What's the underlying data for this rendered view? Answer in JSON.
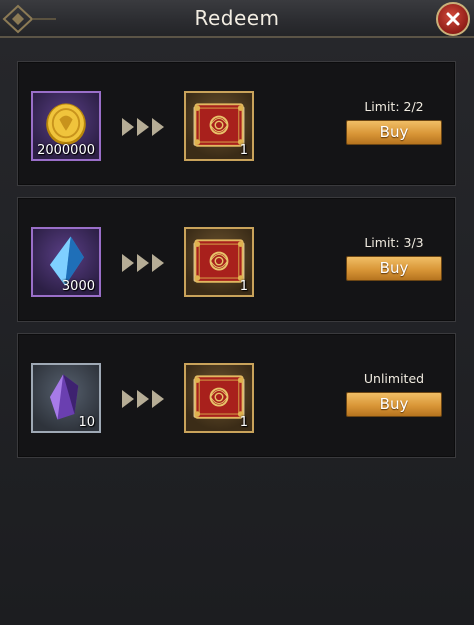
{
  "window": {
    "title": "Redeem"
  },
  "colors": {
    "buy_button": "#d99637",
    "reward_frame": "#c9a35b",
    "close_button": "#b5281f"
  },
  "offers": [
    {
      "cost_icon": "gold-coin-icon",
      "cost_qty": "2000000",
      "reward_icon": "red-scroll-icon",
      "reward_qty": "1",
      "limit_text": "Limit: 2/2",
      "buy_label": "Buy"
    },
    {
      "cost_icon": "blue-crystal-icon",
      "cost_qty": "3000",
      "reward_icon": "red-scroll-icon",
      "reward_qty": "1",
      "limit_text": "Limit: 3/3",
      "buy_label": "Buy"
    },
    {
      "cost_icon": "purple-gem-icon",
      "cost_qty": "10",
      "reward_icon": "red-scroll-icon",
      "reward_qty": "1",
      "limit_text": "Unlimited",
      "buy_label": "Buy"
    }
  ]
}
